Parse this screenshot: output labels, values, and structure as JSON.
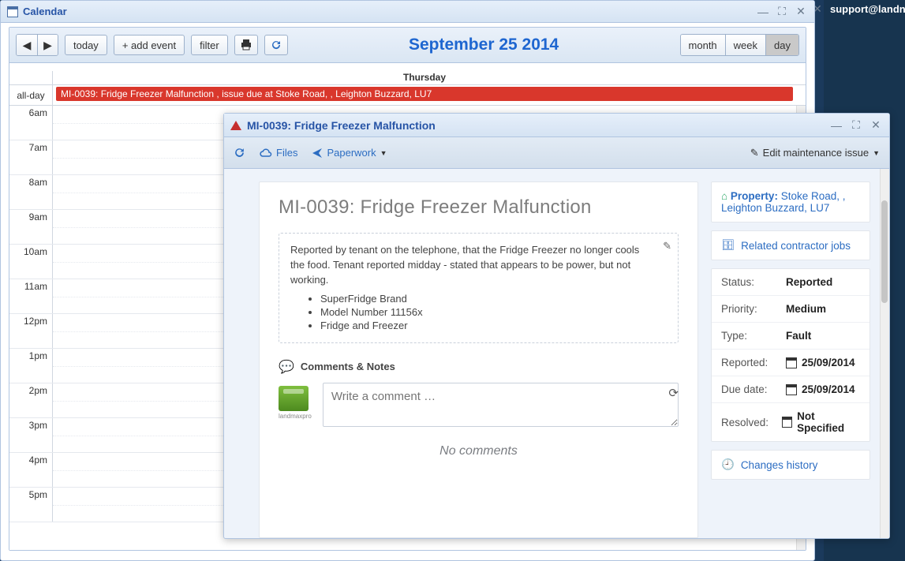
{
  "calendar": {
    "title": "Calendar",
    "date_label": "September 25 2014",
    "today_btn": "today",
    "add_event_btn": "+ add event",
    "filter_btn": "filter",
    "views": {
      "month": "month",
      "week": "week",
      "day": "day"
    },
    "day_header": "Thursday",
    "allday_label": "all-day",
    "allday_event": "MI-0039: Fridge Freezer Malfunction , issue due at Stoke Road, , Leighton Buzzard, LU7",
    "hours": [
      "6am",
      "7am",
      "8am",
      "9am",
      "10am",
      "11am",
      "12pm",
      "1pm",
      "2pm",
      "3pm",
      "4pm",
      "5pm"
    ]
  },
  "dialog": {
    "title": "MI-0039: Fridge Freezer Malfunction",
    "toolbar": {
      "files": "Files",
      "paperwork": "Paperwork",
      "edit": "Edit maintenance issue"
    },
    "heading": "MI-0039: Fridge Freezer Malfunction",
    "description": "Reported by tenant on the telephone, that the Fridge Freezer no longer cools the food. Tenant reported midday - stated that appears to be power, but not working.",
    "bullets": [
      "SuperFridge Brand",
      "Model Number 11156x",
      "Fridge and Freezer"
    ],
    "comments_heading": "Comments & Notes",
    "comment_placeholder": "Write a comment …",
    "no_comments": "No comments",
    "avatar_name": "landmaxpro",
    "property": {
      "label": "Property:",
      "address": "Stoke Road, , Leighton Buzzard, LU7"
    },
    "related_jobs": "Related contractor jobs",
    "meta": {
      "status_k": "Status:",
      "status_v": "Reported",
      "priority_k": "Priority:",
      "priority_v": "Medium",
      "type_k": "Type:",
      "type_v": "Fault",
      "reported_k": "Reported:",
      "reported_v": "25/09/2014",
      "due_k": "Due date:",
      "due_v": "25/09/2014",
      "resolved_k": "Resolved:",
      "resolved_v": "Not Specified"
    },
    "changes": "Changes history"
  },
  "right": {
    "email": "support@landn"
  }
}
